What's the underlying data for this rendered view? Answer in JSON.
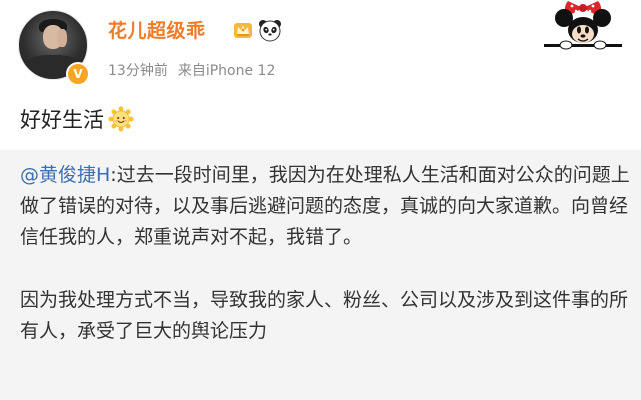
{
  "user": {
    "name": "花儿超级乖",
    "time": "13分钟前",
    "source": "来自iPhone 12",
    "verified_badge": "V"
  },
  "post": {
    "text": "好好生活"
  },
  "repost": {
    "mention": "@黄俊捷H",
    "line1_text": ":过去一段时间里，我因为在处理私人生活和面对公众的问题上做了错误的对待，以及事后逃避问题的态度，真诚的向大家道歉。向曾经信任我的人，郑重说声对不起，我错了。",
    "para2": "因为我处理方式不当，导致我的家人、粉丝、公司以及涉及到这件事的所有人，承受了巨大的舆论压力"
  },
  "icons": {
    "avatar": "user-avatar",
    "verified": "verified-badge-icon",
    "crown": "crown-icon",
    "panda": "panda-icon",
    "sun": "sun-emoji-icon",
    "sticker": "minnie-mouse-sticker"
  },
  "colors": {
    "username": "#f07c2b",
    "meta": "#8a8a8a",
    "mention": "#3b6fb0",
    "repost_bg": "#f4f4f4",
    "badge": "#f6a623"
  }
}
